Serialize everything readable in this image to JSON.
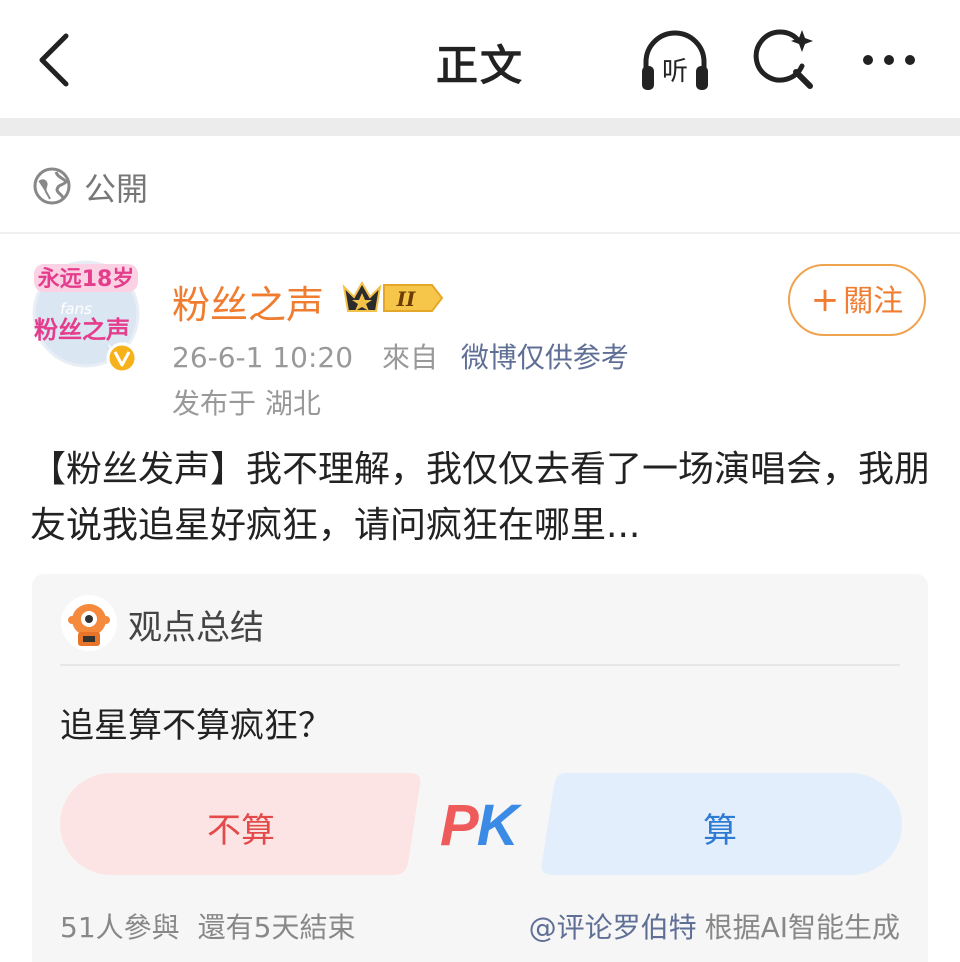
{
  "header": {
    "title": "正文",
    "listen_label": "听",
    "icons": [
      "back-arrow-icon",
      "listen-headphone-icon",
      "search-sparkle-icon",
      "more-dots-icon"
    ]
  },
  "visibility": {
    "label": "公開",
    "icon": "globe-icon"
  },
  "post": {
    "author": "粉丝之声",
    "avatar_text_top": "永远18岁",
    "avatar_text_main": "粉丝之声",
    "avatar_text_en": "fans voice",
    "vip_level": "II",
    "timestamp": "26-6-1 10:20",
    "source_prefix": "來自",
    "source": "微博仅供参考",
    "location": "发布于 湖北",
    "follow_label": "關注",
    "content": "【粉丝发声】我不理解，我仅仅去看了一场演唱会，我朋友说我追星好疯狂，请问疯狂在哪里..."
  },
  "summary_card": {
    "title": "观点总结",
    "question": "追星算不算疯狂？",
    "option_left": "不算",
    "option_right": "算",
    "pk_p": "P",
    "pk_k": "K",
    "participants": "51人參與",
    "remaining": "還有5天結束",
    "mention": "@评论罗伯特",
    "ai_note": "根据AI智能生成"
  },
  "colors": {
    "accent_orange": "#f07c2f",
    "follow_border": "#f0a34e",
    "link_blue": "#5f6f96",
    "option_left_bg": "#fde4e4",
    "option_right_bg": "#e2eefb",
    "pk_red": "#ef5a5a",
    "pk_blue": "#3a8ae6"
  }
}
